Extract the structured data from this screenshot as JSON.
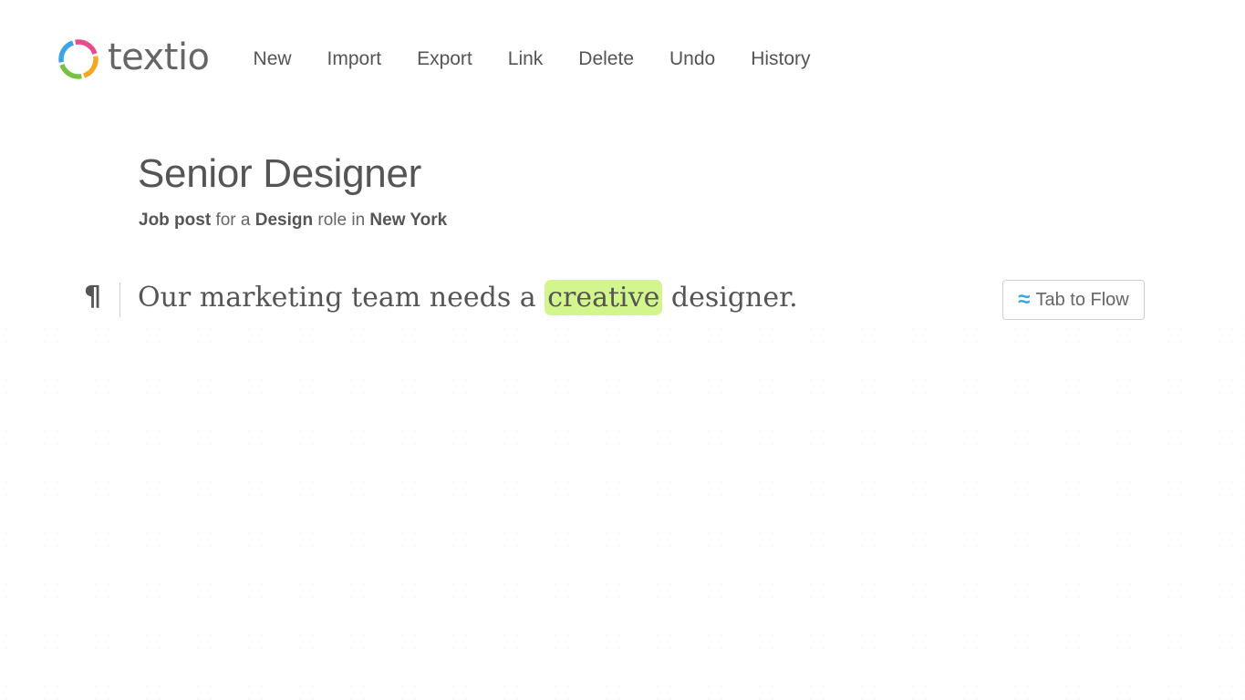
{
  "app": {
    "logo_text": "textio"
  },
  "menu": {
    "items": [
      "New",
      "Import",
      "Export",
      "Link",
      "Delete",
      "Undo",
      "History"
    ]
  },
  "document": {
    "title": "Senior Designer",
    "subtitle": {
      "part1": "Job post",
      "part2": " for a ",
      "part3": "Design",
      "part4": " role in ",
      "part5": "New York"
    },
    "paragraph_marker": "¶",
    "line": {
      "before": "Our marketing team needs a ",
      "highlighted": "creative",
      "after": " designer."
    }
  },
  "flow_button": {
    "icon": "≈",
    "label": "Tab to Flow"
  },
  "colors": {
    "highlight": "#d3f58d",
    "flow_icon": "#3aa6e6",
    "logo_segments": [
      "#e84c8b",
      "#f5a623",
      "#7ac143",
      "#3aa6e6"
    ]
  }
}
